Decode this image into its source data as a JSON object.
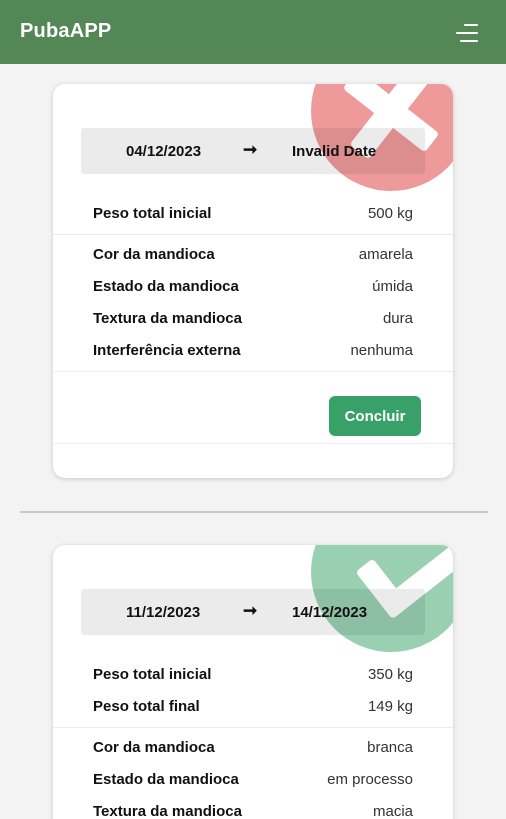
{
  "app": {
    "title": "PubaAPP",
    "menu_icon": "menu-icon"
  },
  "cards": [
    {
      "status": "rejected",
      "status_icon": "x-icon",
      "status_color": "#ef9a9a",
      "date_start": "04/12/2023",
      "arrow": "➞",
      "date_end": "Invalid Date",
      "weights": [
        {
          "label": "Peso total inicial",
          "value": "500 kg"
        }
      ],
      "attributes": [
        {
          "label": "Cor da mandioca",
          "value": "amarela"
        },
        {
          "label": "Estado da mandioca",
          "value": "úmida"
        },
        {
          "label": "Textura da mandioca",
          "value": "dura"
        },
        {
          "label": "Interferência externa",
          "value": "nenhuma"
        }
      ],
      "action_label": "Concluir",
      "action_color": "#38a169"
    },
    {
      "status": "approved",
      "status_icon": "check-icon",
      "status_color": "#9ad0b2",
      "date_start": "11/12/2023",
      "arrow": "➞",
      "date_end": "14/12/2023",
      "weights": [
        {
          "label": "Peso total inicial",
          "value": "350 kg"
        },
        {
          "label": "Peso total final",
          "value": "149 kg"
        }
      ],
      "attributes": [
        {
          "label": "Cor da mandioca",
          "value": "branca"
        },
        {
          "label": "Estado da mandioca",
          "value": "em processo"
        },
        {
          "label": "Textura da mandioca",
          "value": "macia"
        }
      ]
    }
  ],
  "colors": {
    "header": "#548756",
    "background": "#f3f3f3"
  }
}
